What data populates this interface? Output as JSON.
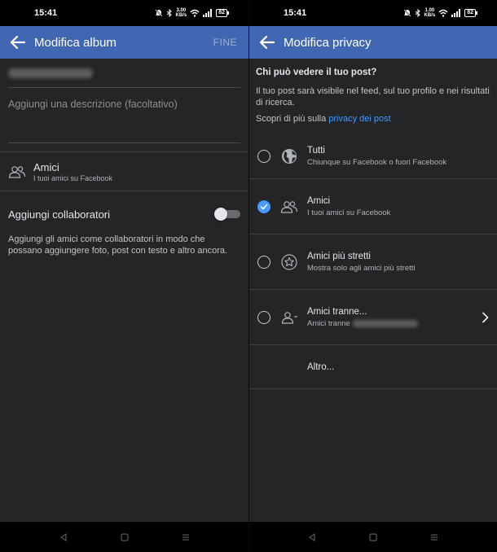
{
  "status": {
    "time": "15:41",
    "net_rate_left": "3.00",
    "net_rate_right": "1.00",
    "net_unit": "KB/s",
    "battery": "82"
  },
  "left": {
    "appbar": {
      "title": "Modifica album",
      "done": "FINE"
    },
    "description_placeholder": "Aggiungi una descrizione (facoltativo)",
    "audience": {
      "title": "Amici",
      "subtitle": "I tuoi amici su Facebook",
      "icon": "friends-icon"
    },
    "collaborators": {
      "label": "Aggiungi collaboratori",
      "enabled": false,
      "help": "Aggiungi gli amici come collaboratori in modo che possano aggiungere foto, post con testo e altro ancora."
    }
  },
  "right": {
    "appbar": {
      "title": "Modifica privacy"
    },
    "question": "Chi può vedere il tuo post?",
    "info": "Il tuo post sarà visibile nel feed, sul tuo profilo e nei risultati di ricerca.",
    "learn_more_prefix": "Scopri di più sulla ",
    "learn_more_link": "privacy dei post",
    "options": [
      {
        "title": "Tutti",
        "subtitle": "Chiunque su Facebook o fuori Facebook",
        "icon": "globe-icon",
        "selected": false
      },
      {
        "title": "Amici",
        "subtitle": "I tuoi amici su Facebook",
        "icon": "friends-icon",
        "selected": true
      },
      {
        "title": "Amici più stretti",
        "subtitle": "Mostra solo agli amici più stretti",
        "icon": "star-icon",
        "selected": false
      },
      {
        "title": "Amici tranne...",
        "subtitle": "Amici tranne",
        "icon": "friends-except-icon",
        "selected": false
      }
    ],
    "other": "Altro..."
  },
  "colors": {
    "header": "#4267b2",
    "background": "#242526",
    "link": "#4599ff"
  }
}
